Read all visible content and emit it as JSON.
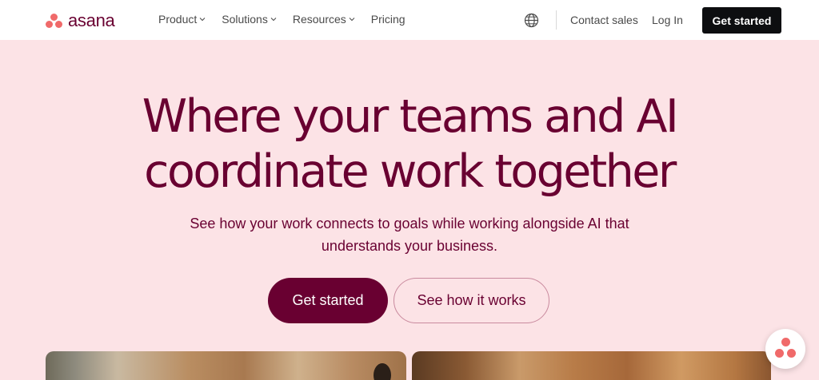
{
  "header": {
    "logo_text": "asana",
    "nav": [
      {
        "label": "Product",
        "has_dropdown": true
      },
      {
        "label": "Solutions",
        "has_dropdown": true
      },
      {
        "label": "Resources",
        "has_dropdown": true
      },
      {
        "label": "Pricing",
        "has_dropdown": false
      }
    ],
    "globe_icon": "globe-icon",
    "contact_label": "Contact sales",
    "login_label": "Log In",
    "cta_label": "Get started"
  },
  "hero": {
    "headline_line1": "Where your teams and AI",
    "headline_line2": "coordinate work together",
    "subtitle": "See how your work connects to goals while working alongside AI that understands your business.",
    "primary_cta": "Get started",
    "secondary_cta": "See how it works"
  },
  "colors": {
    "brand": "#690031",
    "hero_bg": "#fce3e6",
    "logo_coral": "#f06a6a",
    "header_cta_bg": "#0d0e10"
  }
}
